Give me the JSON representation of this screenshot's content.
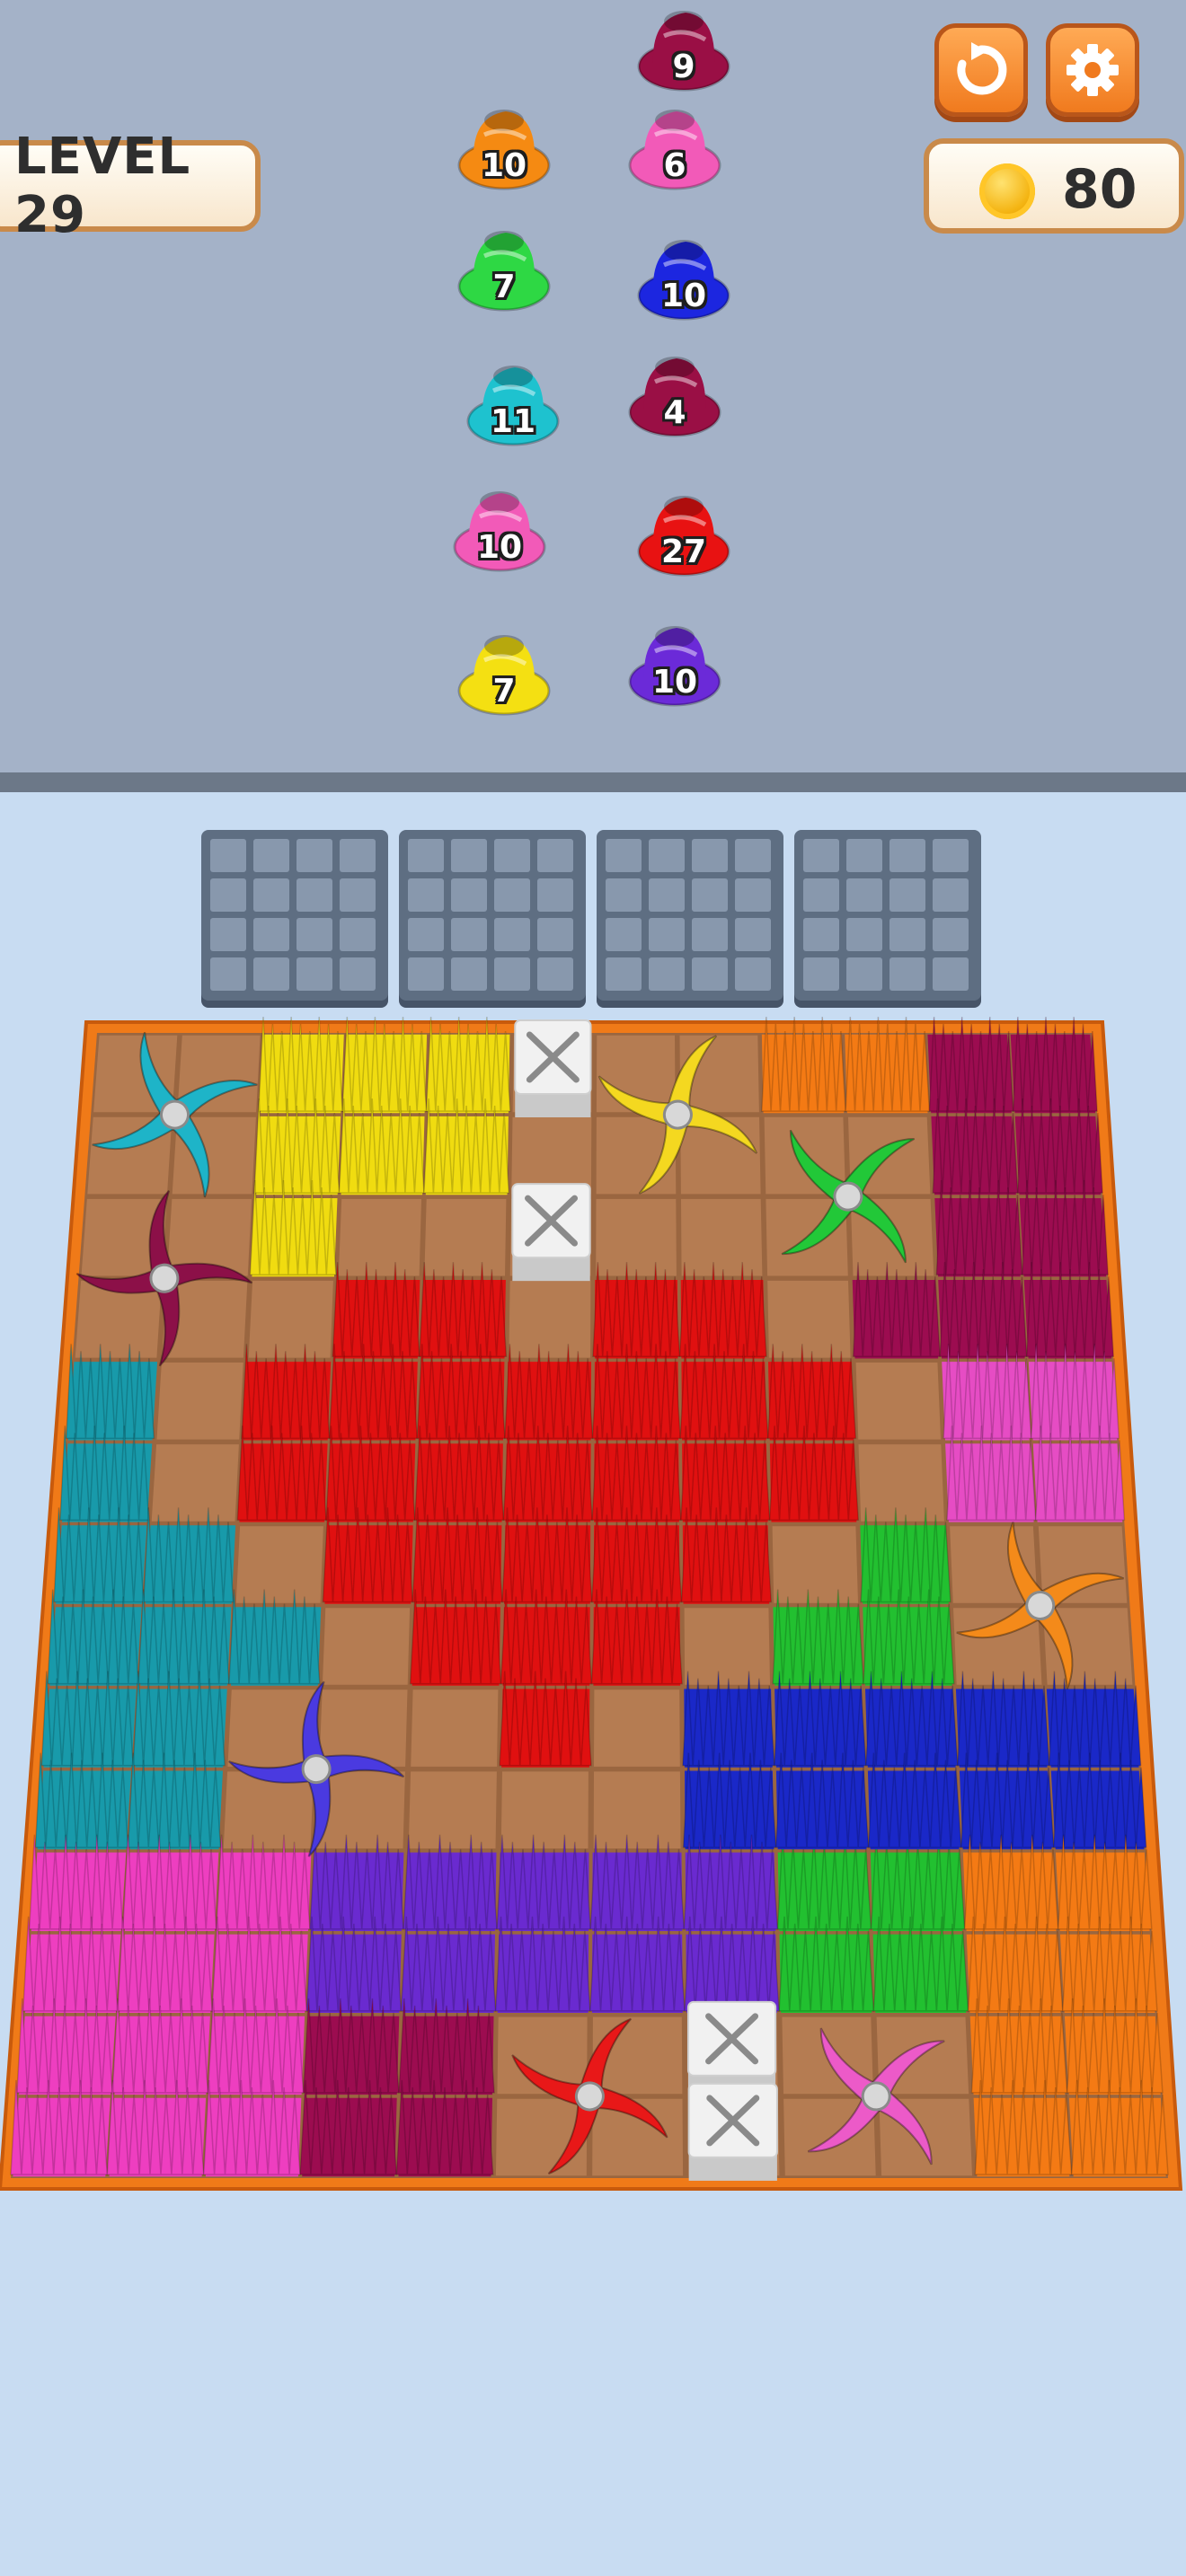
{
  "hud": {
    "level_label": "LEVEL 29",
    "coins": "80",
    "restart_icon": "restart-icon",
    "settings_icon": "gear-icon"
  },
  "yarn_queue": [
    {
      "color": "#9a0f45",
      "count": "9"
    },
    {
      "color": "#f58a12",
      "count": "10"
    },
    {
      "color": "#f25ab8",
      "count": "6"
    },
    {
      "color": "#2ed844",
      "count": "7"
    },
    {
      "color": "#1c26e0",
      "count": "10"
    },
    {
      "color": "#1ec2cf",
      "count": "11"
    },
    {
      "color": "#9a0f45",
      "count": "4"
    },
    {
      "color": "#f25ab8",
      "count": "10"
    },
    {
      "color": "#e81212",
      "count": "27"
    },
    {
      "color": "#f4e012",
      "count": "7"
    },
    {
      "color": "#6b2ad8",
      "count": "10"
    }
  ],
  "colors": {
    "yellow": "#f0dc10",
    "orange": "#f47a14",
    "maroon": "#9c0c50",
    "red": "#e01010",
    "cyan": "#189aaa",
    "pink": "#e64cc4",
    "green": "#22c030",
    "blue": "#1a28c8",
    "purple": "#6a2ad0",
    "magenta": "#ee3ec0",
    "board_frame": "#f07a18",
    "dirt": "#b0784e"
  },
  "grass_regions": [
    {
      "color": "yellow",
      "cells": [
        [
          2,
          0
        ],
        [
          3,
          0
        ],
        [
          4,
          0
        ],
        [
          2,
          1
        ],
        [
          3,
          1
        ],
        [
          4,
          1
        ],
        [
          2,
          2
        ]
      ]
    },
    {
      "color": "orange",
      "cells": [
        [
          8,
          0
        ],
        [
          9,
          0
        ]
      ]
    },
    {
      "color": "maroon",
      "cells": [
        [
          10,
          0
        ],
        [
          11,
          0
        ],
        [
          10,
          1
        ],
        [
          11,
          1
        ],
        [
          10,
          2
        ],
        [
          11,
          2
        ],
        [
          9,
          3
        ],
        [
          10,
          3
        ],
        [
          11,
          3
        ]
      ]
    },
    {
      "color": "red",
      "cells": [
        [
          3,
          3
        ],
        [
          4,
          3
        ],
        [
          6,
          3
        ],
        [
          7,
          3
        ],
        [
          2,
          4
        ],
        [
          3,
          4
        ],
        [
          4,
          4
        ],
        [
          5,
          4
        ],
        [
          6,
          4
        ],
        [
          7,
          4
        ],
        [
          8,
          4
        ],
        [
          2,
          5
        ],
        [
          3,
          5
        ],
        [
          4,
          5
        ],
        [
          5,
          5
        ],
        [
          6,
          5
        ],
        [
          7,
          5
        ],
        [
          8,
          5
        ],
        [
          3,
          6
        ],
        [
          4,
          6
        ],
        [
          5,
          6
        ],
        [
          6,
          6
        ],
        [
          7,
          6
        ],
        [
          4,
          7
        ],
        [
          5,
          7
        ],
        [
          6,
          7
        ],
        [
          5,
          8
        ]
      ]
    },
    {
      "color": "cyan",
      "cells": [
        [
          0,
          4
        ],
        [
          0,
          5
        ],
        [
          0,
          6
        ],
        [
          1,
          6
        ],
        [
          0,
          7
        ],
        [
          1,
          7
        ],
        [
          2,
          7
        ],
        [
          0,
          8
        ],
        [
          1,
          8
        ],
        [
          0,
          9
        ],
        [
          1,
          9
        ]
      ]
    },
    {
      "color": "pink",
      "cells": [
        [
          10,
          4
        ],
        [
          11,
          4
        ],
        [
          10,
          5
        ],
        [
          11,
          5
        ]
      ]
    },
    {
      "color": "green",
      "cells": [
        [
          9,
          6
        ],
        [
          8,
          7
        ],
        [
          9,
          7
        ],
        [
          8,
          10
        ],
        [
          9,
          10
        ],
        [
          8,
          11
        ],
        [
          9,
          11
        ]
      ]
    },
    {
      "color": "blue",
      "cells": [
        [
          7,
          8
        ],
        [
          8,
          8
        ],
        [
          9,
          8
        ],
        [
          10,
          8
        ],
        [
          11,
          8
        ],
        [
          7,
          9
        ],
        [
          8,
          9
        ],
        [
          9,
          9
        ],
        [
          10,
          9
        ],
        [
          11,
          9
        ]
      ]
    },
    {
      "color": "magenta",
      "cells": [
        [
          0,
          10
        ],
        [
          1,
          10
        ],
        [
          2,
          10
        ],
        [
          0,
          11
        ],
        [
          1,
          11
        ],
        [
          2,
          11
        ],
        [
          0,
          12
        ],
        [
          1,
          12
        ],
        [
          2,
          12
        ],
        [
          0,
          13
        ],
        [
          1,
          13
        ],
        [
          2,
          13
        ]
      ]
    },
    {
      "color": "purple",
      "cells": [
        [
          3,
          10
        ],
        [
          4,
          10
        ],
        [
          5,
          10
        ],
        [
          6,
          10
        ],
        [
          7,
          10
        ],
        [
          3,
          11
        ],
        [
          4,
          11
        ],
        [
          5,
          11
        ],
        [
          6,
          11
        ],
        [
          7,
          11
        ]
      ]
    },
    {
      "color": "maroon",
      "cells": [
        [
          3,
          12
        ],
        [
          4,
          12
        ],
        [
          3,
          13
        ],
        [
          4,
          13
        ]
      ]
    },
    {
      "color": "orange",
      "cells": [
        [
          10,
          10
        ],
        [
          11,
          10
        ],
        [
          10,
          11
        ],
        [
          11,
          11
        ],
        [
          10,
          12
        ],
        [
          11,
          12
        ],
        [
          10,
          13
        ],
        [
          11,
          13
        ]
      ]
    }
  ],
  "blocked_cells": [
    [
      5,
      0
    ],
    [
      5,
      2
    ],
    [
      7,
      12
    ],
    [
      7,
      13
    ]
  ],
  "spinners": [
    {
      "color": "cyan",
      "col": 0.5,
      "row": 0.5
    },
    {
      "color": "maroon",
      "col": 0.5,
      "row": 2.5
    },
    {
      "color": "yellow",
      "col": 6.5,
      "row": 0.5
    },
    {
      "color": "green",
      "col": 8.5,
      "row": 1.5
    },
    {
      "color": "orange",
      "col": 10.5,
      "row": 6.5
    },
    {
      "color": "purple",
      "col": 2.5,
      "row": 8.5
    },
    {
      "color": "red",
      "col": 5.5,
      "row": 12.5
    },
    {
      "color": "pink",
      "col": 8.5,
      "row": 12.5
    }
  ],
  "spinner_colors": {
    "cyan": "#1eb4c8",
    "maroon": "#8c1048",
    "yellow": "#f4d820",
    "green": "#22c838",
    "orange": "#f48a1a",
    "purple": "#4a3ae0",
    "red": "#e81818",
    "pink": "#ec5ac8"
  }
}
